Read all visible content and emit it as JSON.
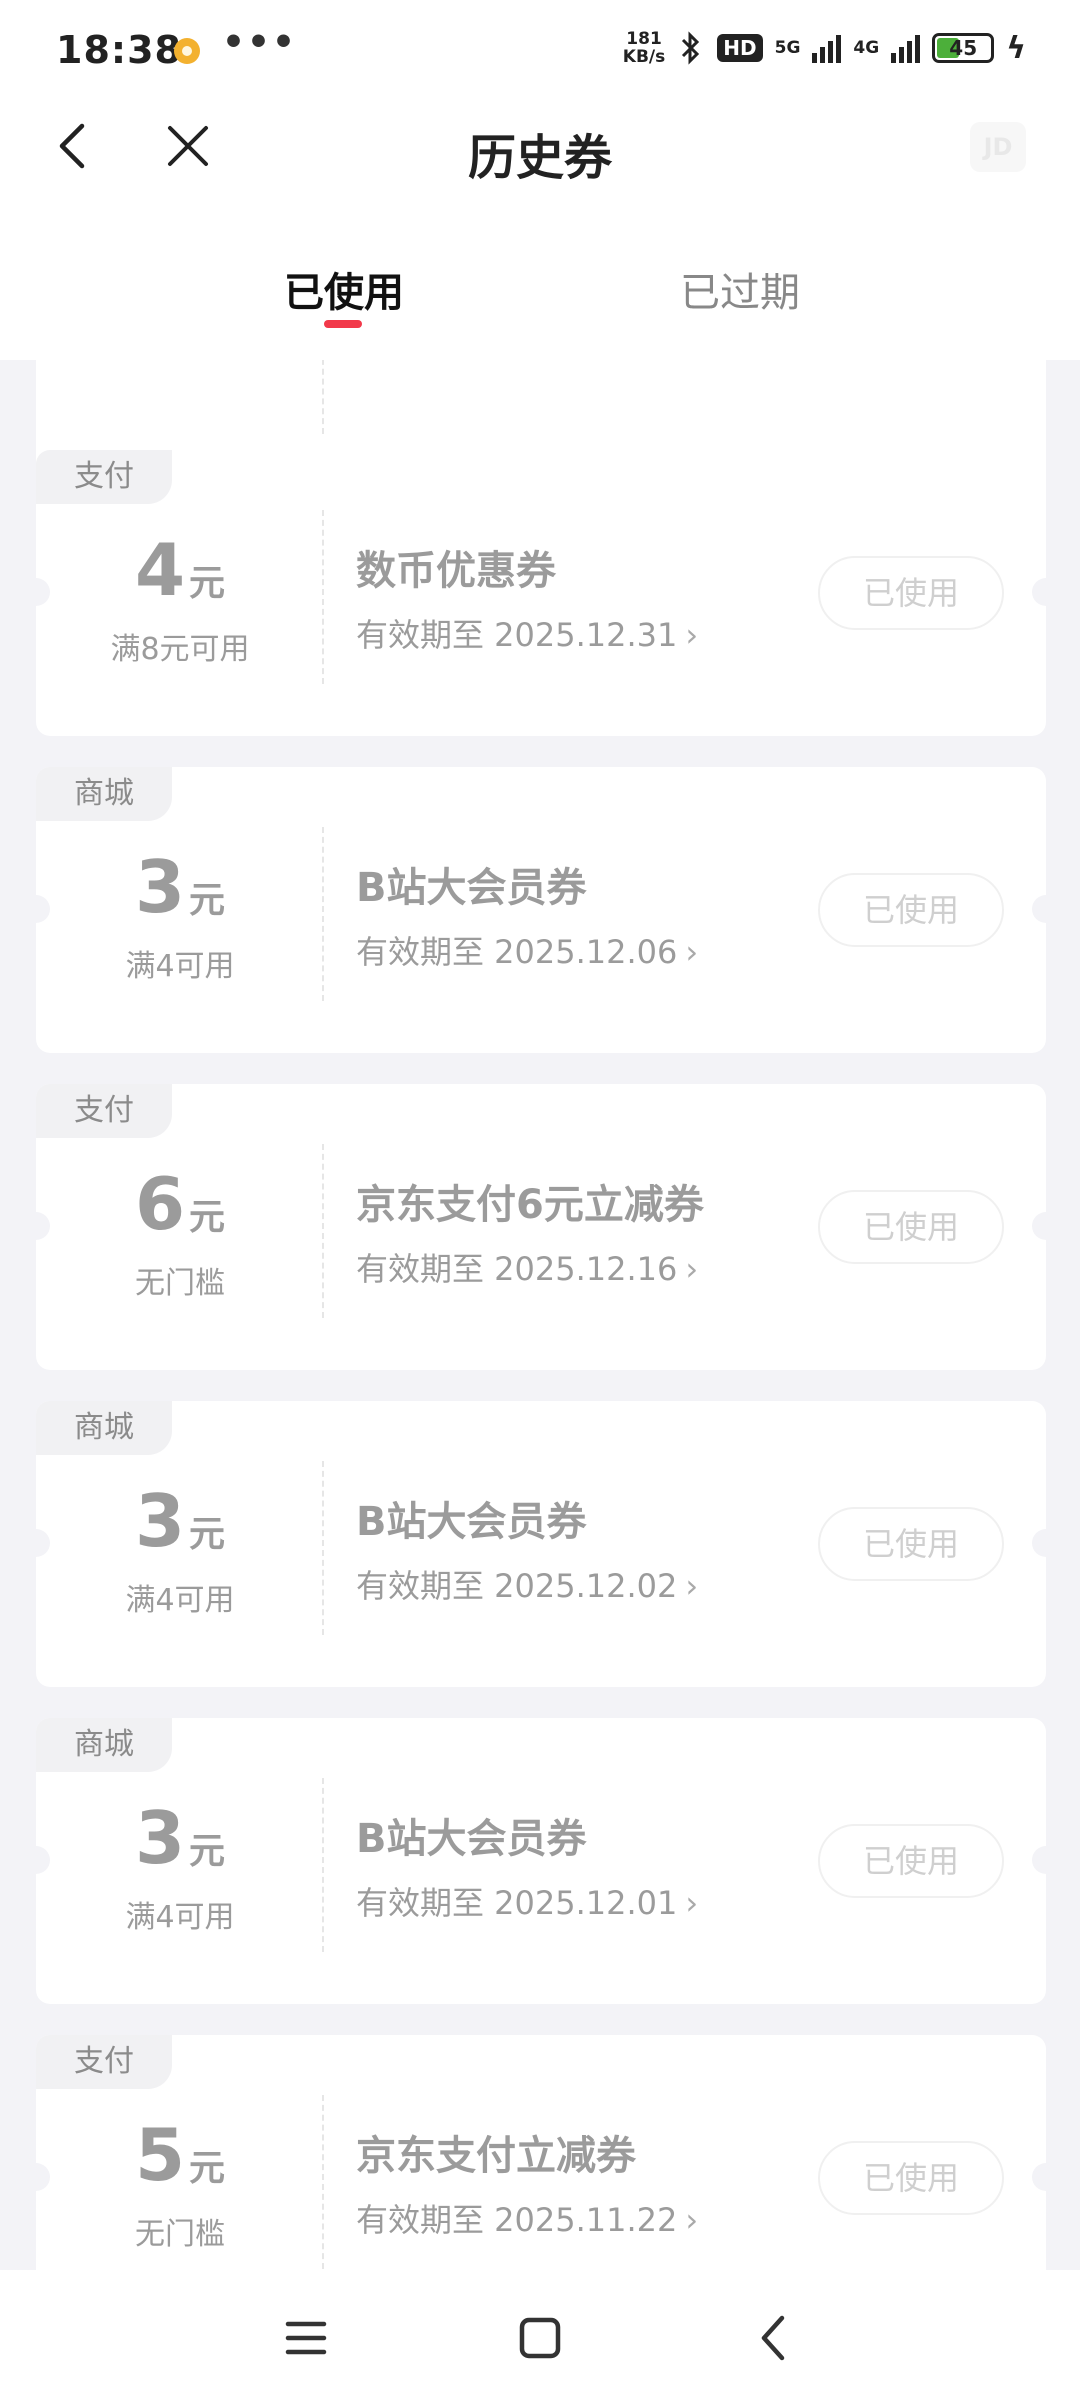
{
  "status_bar": {
    "time": "18:38",
    "more": "•••",
    "speed_top": "181",
    "speed_bottom": "KB/s",
    "hd": "HD",
    "net_5g": "5G",
    "net_4g": "4G",
    "battery": "45"
  },
  "header": {
    "title": "历史券",
    "logo": "JD",
    "tabs": [
      {
        "label": "已使用",
        "active": true
      },
      {
        "label": "已过期",
        "active": false
      }
    ]
  },
  "coupons": [
    {
      "tag": "支付",
      "amount": "4",
      "unit": "元",
      "condition": "满8元可用",
      "name": "数币优惠券",
      "valid": "有效期至 2025.12.31",
      "status": "已使用"
    },
    {
      "tag": "商城",
      "amount": "3",
      "unit": "元",
      "condition": "满4可用",
      "name": "B站大会员券",
      "valid": "有效期至 2025.12.06",
      "status": "已使用"
    },
    {
      "tag": "支付",
      "amount": "6",
      "unit": "元",
      "condition": "无门槛",
      "name": "京东支付6元立减券",
      "valid": "有效期至 2025.12.16",
      "status": "已使用"
    },
    {
      "tag": "商城",
      "amount": "3",
      "unit": "元",
      "condition": "满4可用",
      "name": "B站大会员券",
      "valid": "有效期至 2025.12.02",
      "status": "已使用"
    },
    {
      "tag": "商城",
      "amount": "3",
      "unit": "元",
      "condition": "满4可用",
      "name": "B站大会员券",
      "valid": "有效期至 2025.12.01",
      "status": "已使用"
    },
    {
      "tag": "支付",
      "amount": "5",
      "unit": "元",
      "condition": "无门槛",
      "name": "京东支付立减券",
      "valid": "有效期至 2025.11.22",
      "status": "已使用"
    }
  ],
  "colors": {
    "accent": "#f2394a",
    "background": "#f3f3f7",
    "muted_text": "#9b9b9b"
  }
}
